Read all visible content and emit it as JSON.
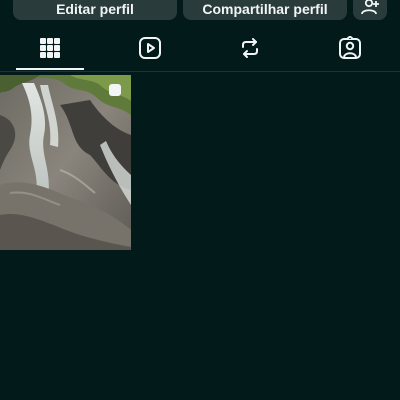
{
  "profile_actions": {
    "edit_label": "Editar perfil",
    "share_label": "Compartilhar perfil",
    "add_person_icon": "person-add-icon"
  },
  "tabs": [
    {
      "icon": "grid-icon",
      "selected": true
    },
    {
      "icon": "reels-icon",
      "selected": false
    },
    {
      "icon": "repost-icon",
      "selected": false
    },
    {
      "icon": "tagged-icon",
      "selected": false
    }
  ],
  "posts": [
    {
      "subject": "waterfall photo",
      "multi_icon": "multi-select-icon"
    }
  ],
  "colors": {
    "background": "#021a1a",
    "button": "#2a3b3c",
    "text": "#f2f5f5"
  }
}
